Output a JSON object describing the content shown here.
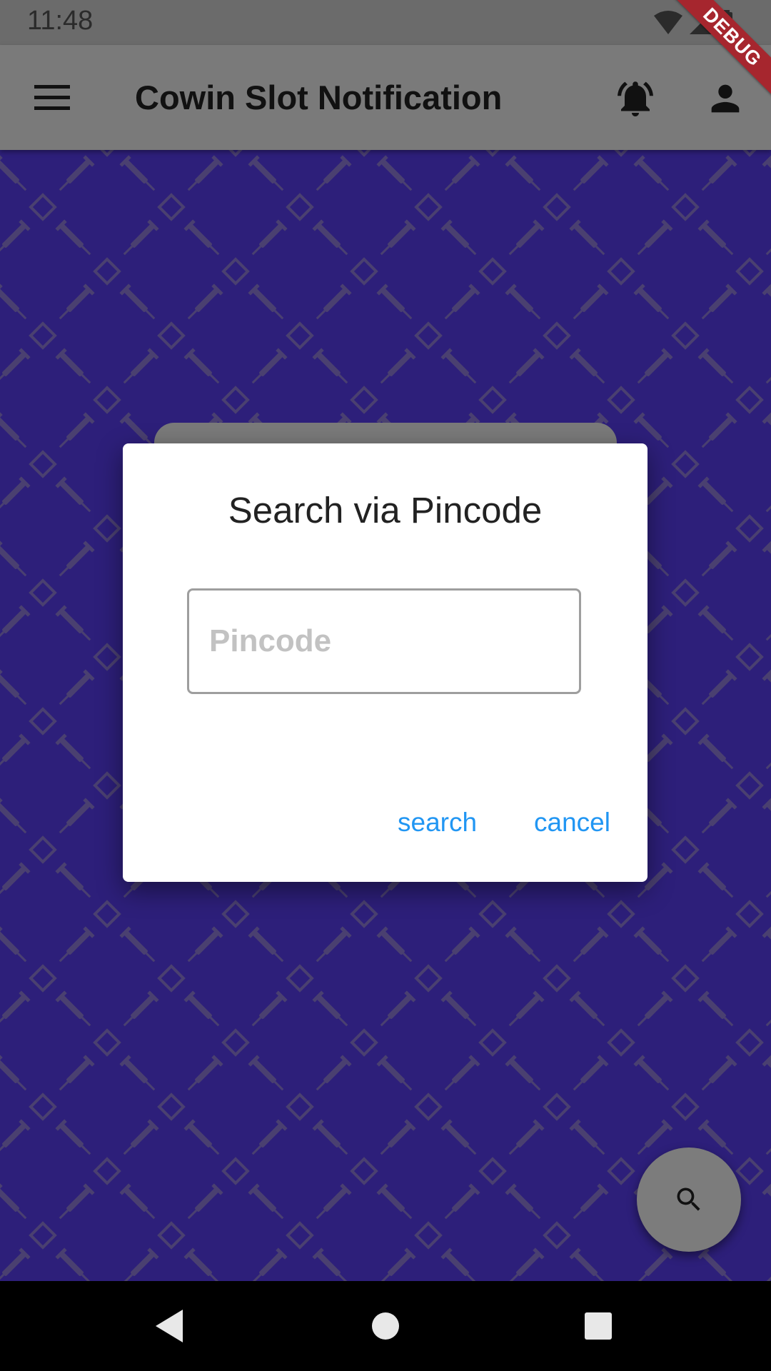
{
  "status_bar": {
    "time": "11:48",
    "icons": [
      "wifi-icon",
      "signal-icon",
      "battery-icon"
    ]
  },
  "debug_banner": "DEBUG",
  "app_bar": {
    "title": "Cowin Slot Notification",
    "icons": [
      "menu-icon",
      "notification-bell-icon",
      "account-icon"
    ]
  },
  "dialog": {
    "title": "Search via Pincode",
    "pincode_placeholder": "Pincode",
    "pincode_value": "",
    "search_label": "search",
    "cancel_label": "cancel"
  },
  "fab": {
    "icon": "search-icon"
  },
  "nav_bar": {
    "icons": [
      "back-icon",
      "home-icon",
      "recents-icon"
    ]
  },
  "colors": {
    "background": "#2d1f7a",
    "pattern": "#4a4070",
    "app_bar": "#7a7a7a",
    "status_bar": "#6b6b6b",
    "dialog_button": "#2196f3",
    "debug_banner": "#a6262e"
  }
}
